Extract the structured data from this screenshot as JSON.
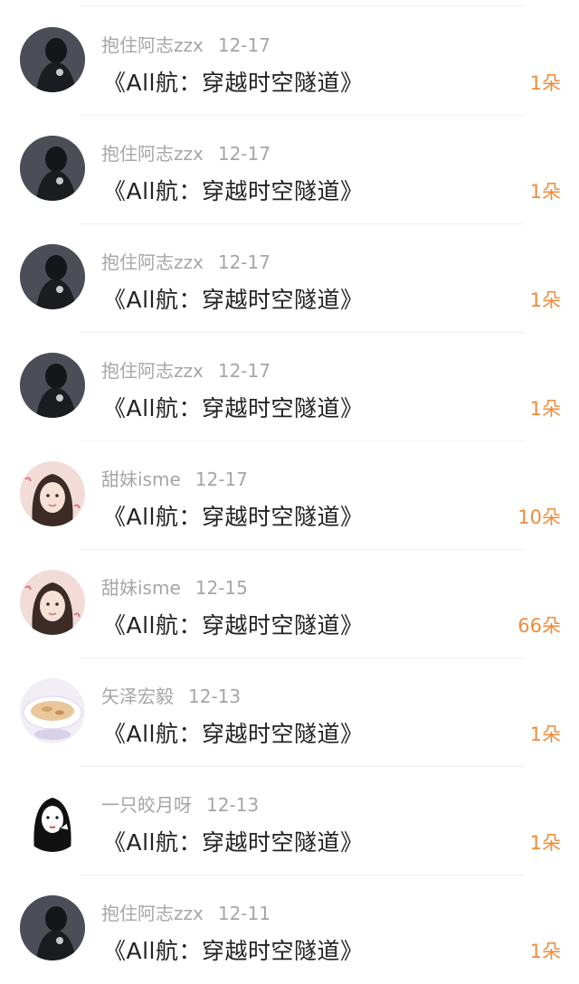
{
  "colors": {
    "username": "#a6a6a6",
    "title": "#222222",
    "count": "#f08c3a",
    "divider": "#f0f0f0"
  },
  "gifts": [
    {
      "user": "抱住阿志zzx",
      "date": "12-17",
      "title": "《All航：穿越时空隧道》",
      "count": "1朵",
      "avatar": "dark-portrait-avatar"
    },
    {
      "user": "抱住阿志zzx",
      "date": "12-17",
      "title": "《All航：穿越时空隧道》",
      "count": "1朵",
      "avatar": "dark-portrait-avatar"
    },
    {
      "user": "抱住阿志zzx",
      "date": "12-17",
      "title": "《All航：穿越时空隧道》",
      "count": "1朵",
      "avatar": "dark-portrait-avatar"
    },
    {
      "user": "抱住阿志zzx",
      "date": "12-17",
      "title": "《All航：穿越时空隧道》",
      "count": "1朵",
      "avatar": "dark-portrait-avatar"
    },
    {
      "user": "甜妹isme",
      "date": "12-17",
      "title": "《All航：穿越时空隧道》",
      "count": "10朵",
      "avatar": "girl-pink-avatar"
    },
    {
      "user": "甜妹isme",
      "date": "12-15",
      "title": "《All航：穿越时空隧道》",
      "count": "66朵",
      "avatar": "girl-pink-avatar"
    },
    {
      "user": "矢泽宏毅",
      "date": "12-13",
      "title": "《All航：穿越时空隧道》",
      "count": "1朵",
      "avatar": "food-plate-avatar"
    },
    {
      "user": "一只皎月呀",
      "date": "12-13",
      "title": "《All航：穿越时空隧道》",
      "count": "1朵",
      "avatar": "sketch-girl-avatar"
    },
    {
      "user": "抱住阿志zzx",
      "date": "12-11",
      "title": "《All航：穿越时空隧道》",
      "count": "1朵",
      "avatar": "dark-portrait-avatar"
    }
  ]
}
